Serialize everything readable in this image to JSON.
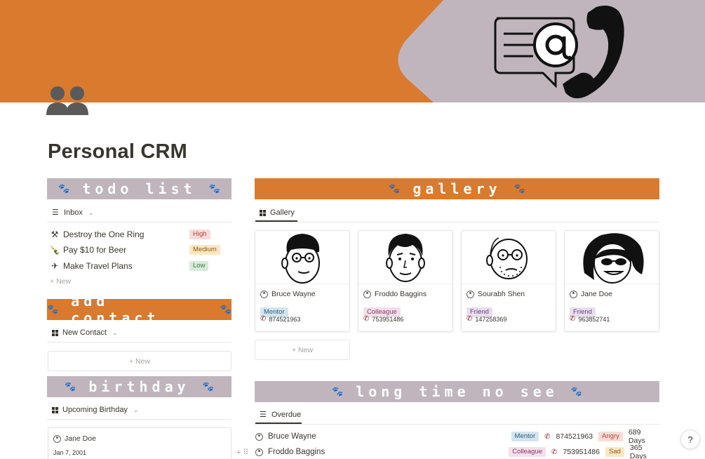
{
  "page": {
    "title": "Personal CRM"
  },
  "colors": {
    "orange": "#d97a2e",
    "mauve": "#c0b5bd",
    "text": "#37352f"
  },
  "sections": {
    "todo": {
      "heading": "todo list",
      "view_label": "Inbox"
    },
    "add_contact": {
      "heading": "add contact",
      "view_label": "New Contact"
    },
    "birthday": {
      "heading": "birthday",
      "view_label": "Upcoming Birthday"
    },
    "gallery": {
      "heading": "gallery",
      "view_label": "Gallery"
    },
    "long_time": {
      "heading": "long time no see",
      "view_label": "Overdue"
    }
  },
  "todo_items": [
    {
      "icon": "hammer-icon",
      "name": "Destroy the One Ring",
      "priority": "High"
    },
    {
      "icon": "bottle-icon",
      "name": "Pay $10 for Beer",
      "priority": "Medium"
    },
    {
      "icon": "airplane-icon",
      "name": "Make Travel Plans",
      "priority": "Low"
    }
  ],
  "labels": {
    "new": "New"
  },
  "contacts": [
    {
      "name": "Bruce Wayne",
      "relation": "Mentor",
      "phone": "874521963"
    },
    {
      "name": "Froddo Baggins",
      "relation": "Colleague",
      "phone": "753951486"
    },
    {
      "name": "Sourabh Shen",
      "relation": "Friend",
      "phone": "147258369"
    },
    {
      "name": "Jane Doe",
      "relation": "Friend",
      "phone": "963852741"
    }
  ],
  "birthdays": [
    {
      "name": "Jane Doe",
      "date": "Jan 7, 2001"
    }
  ],
  "overdue": [
    {
      "name": "Bruce Wayne",
      "relation": "Mentor",
      "phone": "874521963",
      "mood": "Angry",
      "days": "689 Days"
    },
    {
      "name": "Froddo Baggins",
      "relation": "Colleague",
      "phone": "753951486",
      "mood": "Sad",
      "days": "365 Days"
    }
  ],
  "help": {
    "label": "?"
  }
}
